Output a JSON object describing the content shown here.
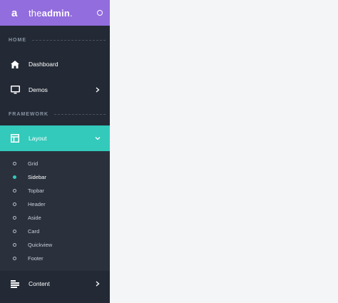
{
  "brand": {
    "logo": "a",
    "name_prefix": "the",
    "name_bold": "admin",
    "name_suffix": "."
  },
  "sections": {
    "home_title": "HOME",
    "framework_title": "FRAMEWORK"
  },
  "nav": {
    "dashboard": "Dashboard",
    "demos": "Demos",
    "layout": "Layout",
    "content": "Content"
  },
  "layout_submenu": [
    "Grid",
    "Sidebar",
    "Topbar",
    "Header",
    "Aside",
    "Card",
    "Quickview",
    "Footer"
  ],
  "active_submenu_item": "Sidebar",
  "colors": {
    "brand": "#926dde",
    "accent": "#33cabb",
    "sidebar": "#232a35",
    "submenu": "#2a313d",
    "page": "#f4f5f7"
  },
  "icons": {
    "dashboard": "home-icon",
    "demos": "monitor-icon",
    "layout": "layout-icon",
    "content": "content-icon"
  }
}
